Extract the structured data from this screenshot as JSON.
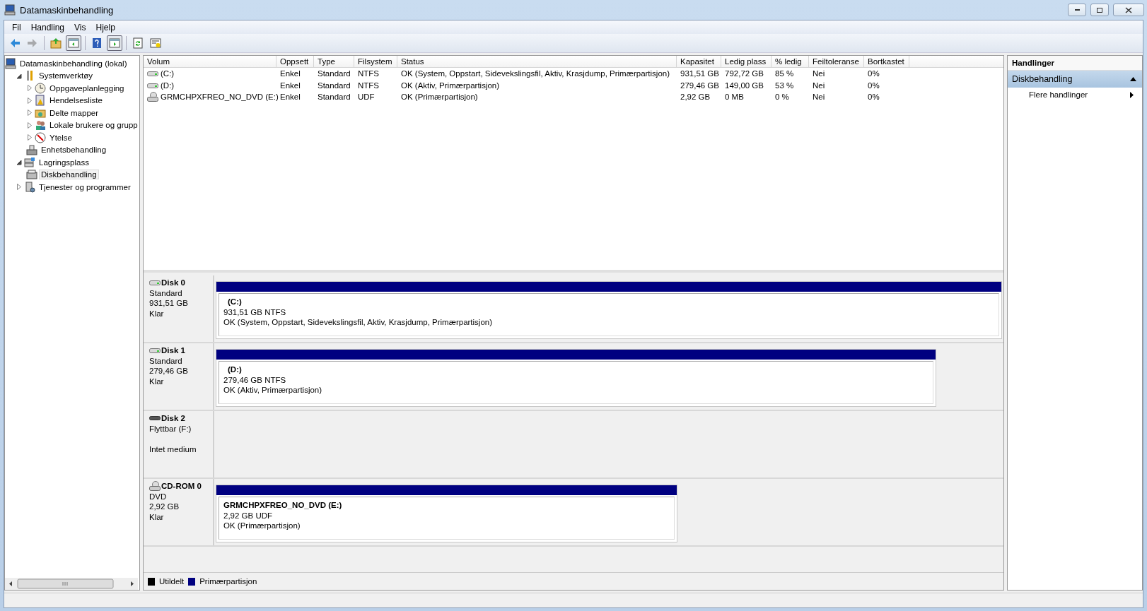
{
  "window": {
    "title": "Datamaskinbehandling"
  },
  "menu": [
    "Fil",
    "Handling",
    "Vis",
    "Hjelp"
  ],
  "toolbar": [
    {
      "buttons": [
        {
          "kind": "back",
          "pressed": false,
          "disabled": false
        },
        {
          "kind": "forward",
          "pressed": false,
          "disabled": true
        }
      ]
    },
    {
      "buttons": [
        {
          "kind": "up",
          "pressed": false,
          "disabled": false
        },
        {
          "kind": "tree-pane",
          "pressed": true,
          "disabled": false
        }
      ]
    },
    {
      "buttons": [
        {
          "kind": "help",
          "pressed": false,
          "disabled": false
        },
        {
          "kind": "action-pane",
          "pressed": true,
          "disabled": false
        }
      ]
    },
    {
      "buttons": [
        {
          "kind": "refresh",
          "pressed": false,
          "disabled": false
        },
        {
          "kind": "properties",
          "pressed": false,
          "disabled": false
        }
      ]
    }
  ],
  "tree": [
    {
      "label": "Datamaskinbehandling (lokal)",
      "kind": "computer",
      "selected": false,
      "children": [
        {
          "label": "Systemverktøy",
          "kind": "tools",
          "expanded": true,
          "selected": false,
          "children": [
            {
              "label": "Oppgaveplanlegging",
              "kind": "clock",
              "expanded": false,
              "selected": false
            },
            {
              "label": "Hendelsesliste",
              "kind": "log",
              "expanded": false,
              "selected": false
            },
            {
              "label": "Delte mapper",
              "kind": "share",
              "expanded": false,
              "selected": false
            },
            {
              "label": "Lokale brukere og grupp",
              "kind": "users",
              "expanded": false,
              "selected": false
            },
            {
              "label": "Ytelse",
              "kind": "gauge",
              "expanded": false,
              "selected": false
            },
            {
              "label": "Enhetsbehandling",
              "kind": "device",
              "selected": false
            }
          ]
        },
        {
          "label": "Lagringsplass",
          "kind": "storage",
          "expanded": true,
          "selected": false,
          "children": [
            {
              "label": "Diskbehandling",
              "kind": "disk",
              "selected": true
            }
          ]
        },
        {
          "label": "Tjenester og programmer",
          "kind": "services",
          "expanded": false,
          "selected": false
        }
      ]
    }
  ],
  "volumes": {
    "columns": [
      "Volum",
      "Oppsett",
      "Type",
      "Filsystem",
      "Status",
      "Kapasitet",
      "Ledig plass",
      "% ledig",
      "Feiltoleranse",
      "Bortkastet"
    ],
    "rows": [
      {
        "kind": "disk",
        "cells": [
          "(C:)",
          "Enkel",
          "Standard",
          "NTFS",
          "OK (System, Oppstart, Sidevekslingsfil, Aktiv, Krasjdump, Primærpartisjon)",
          "931,51 GB",
          "792,72 GB",
          "85 %",
          "Nei",
          "0%"
        ]
      },
      {
        "kind": "disk",
        "cells": [
          "(D:)",
          "Enkel",
          "Standard",
          "NTFS",
          "OK (Aktiv, Primærpartisjon)",
          "279,46 GB",
          "149,00 GB",
          "53 %",
          "Nei",
          "0%"
        ]
      },
      {
        "kind": "cdrom",
        "cells": [
          "GRMCHPXFREO_NO_DVD (E:)",
          "Enkel",
          "Standard",
          "UDF",
          "OK (Primærpartisjon)",
          "2,92 GB",
          "0 MB",
          "0 %",
          "Nei",
          "0%"
        ]
      }
    ]
  },
  "disks": [
    {
      "kind": "disk",
      "name": "Disk 0",
      "type": "Standard",
      "size": "931,51 GB",
      "status": "Klar",
      "partitions": [
        {
          "label": "(C:)",
          "size_fs": "931,51 GB NTFS",
          "status": "OK (System, Oppstart, Sidevekslingsfil, Aktiv, Krasjdump, Primærpartisjon)",
          "color": "#000080"
        }
      ]
    },
    {
      "kind": "disk",
      "name": "Disk 1",
      "type": "Standard",
      "size": "279,46 GB",
      "status": "Klar",
      "partitions": [
        {
          "label": "(D:)",
          "size_fs": "279,46 GB NTFS",
          "status": "OK (Aktiv, Primærpartisjon)",
          "color": "#000080"
        }
      ]
    },
    {
      "kind": "removable",
      "name": "Disk 2",
      "type": "Flyttbar (F:)",
      "status": "Intet medium"
    },
    {
      "kind": "cdrom",
      "name": "CD-ROM 0",
      "type": "DVD",
      "size": "2,92 GB",
      "status": "Klar",
      "partitions": [
        {
          "label": "GRMCHPXFREO_NO_DVD  (E:)",
          "size_fs": "2,92 GB UDF",
          "status": "OK (Primærpartisjon)",
          "color": "#000080"
        }
      ]
    }
  ],
  "legend": [
    {
      "label": "Utildelt",
      "color": "#000000"
    },
    {
      "label": "Primærpartisjon",
      "color": "#000080"
    }
  ],
  "actions": {
    "title": "Handlinger",
    "sections": [
      {
        "label": "Diskbehandling",
        "expanded": true,
        "items": [
          {
            "label": "Flere handlinger",
            "submenu": true
          }
        ]
      }
    ]
  }
}
